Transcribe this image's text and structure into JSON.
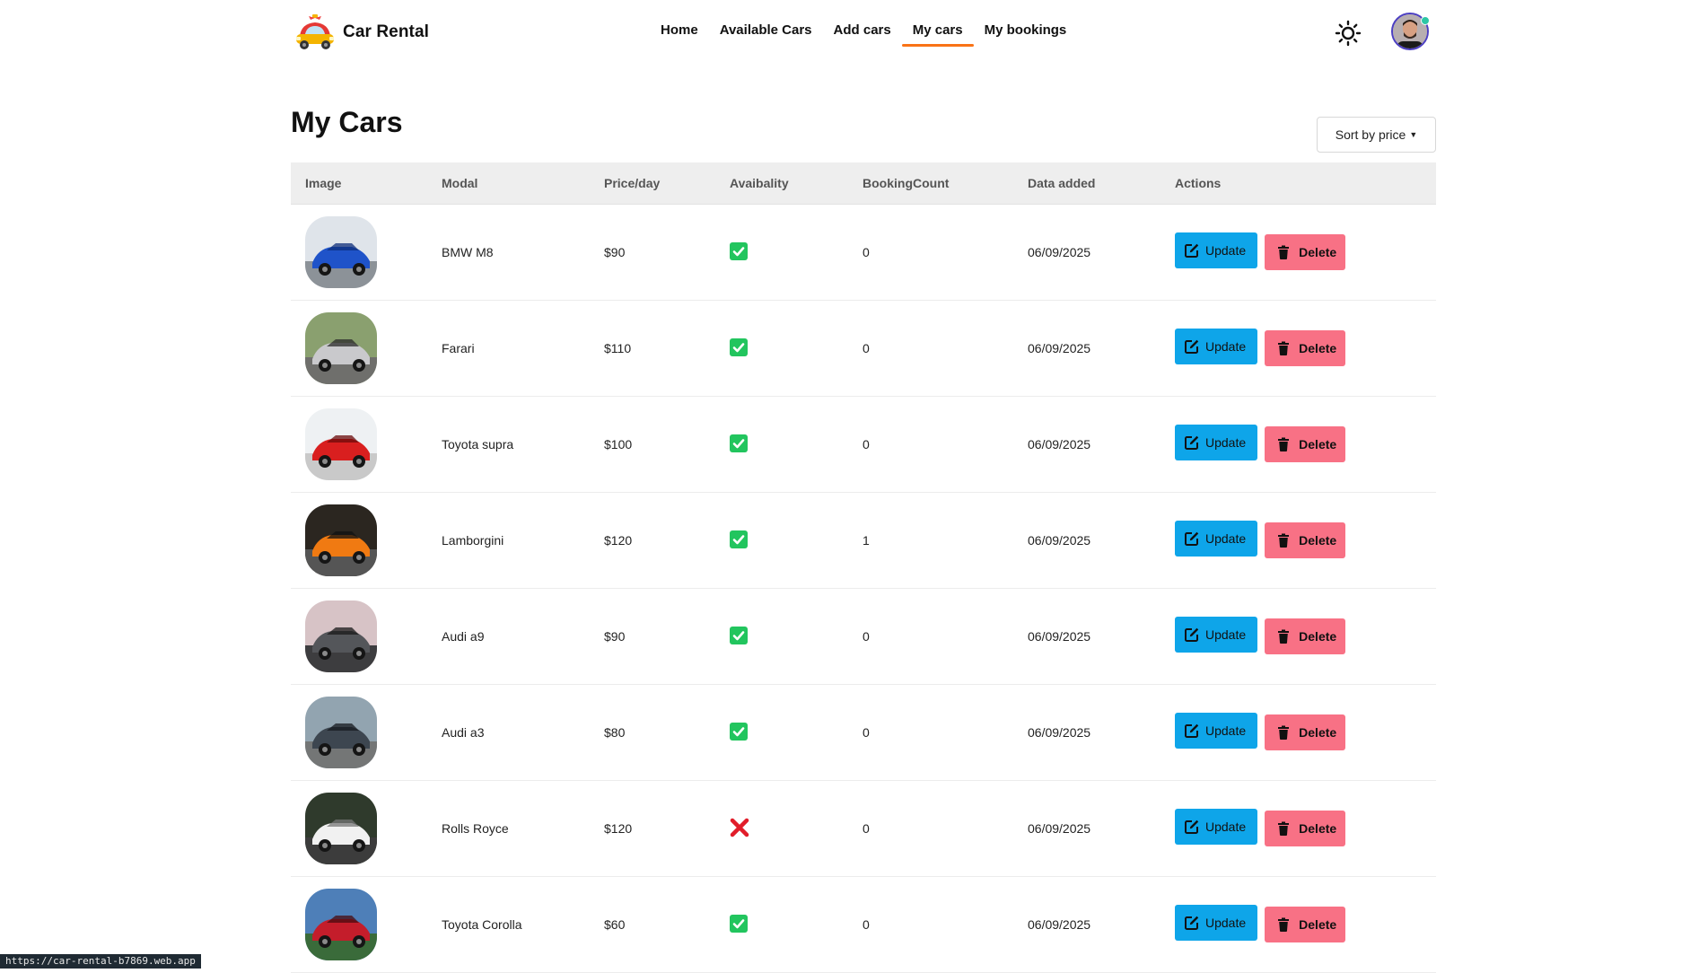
{
  "brand": {
    "name": "Car Rental"
  },
  "nav": {
    "links": [
      {
        "label": "Home",
        "active": false
      },
      {
        "label": "Available Cars",
        "active": false
      },
      {
        "label": "Add cars",
        "active": false
      },
      {
        "label": "My cars",
        "active": true
      },
      {
        "label": "My bookings",
        "active": false
      }
    ]
  },
  "header_icons": {
    "theme": "sun-icon",
    "avatar": "user-avatar"
  },
  "page": {
    "title": "My Cars",
    "sort_label": "Sort by price"
  },
  "table": {
    "headers": [
      "Image",
      "Modal",
      "Price/day",
      "Avaibality",
      "BookingCount",
      "Data added",
      "Actions"
    ],
    "update_label": "Update",
    "delete_label": "Delete",
    "rows": [
      {
        "model": "BMW M8",
        "price": "$90",
        "available": true,
        "count": "0",
        "date": "06/09/2025",
        "photo": "blue-car"
      },
      {
        "model": "Farari",
        "price": "$110",
        "available": true,
        "count": "0",
        "date": "06/09/2025",
        "photo": "silver-supercar"
      },
      {
        "model": "Toyota supra",
        "price": "$100",
        "available": true,
        "count": "0",
        "date": "06/09/2025",
        "photo": "red-classic-car"
      },
      {
        "model": "Lamborgini",
        "price": "$120",
        "available": true,
        "count": "1",
        "date": "06/09/2025",
        "photo": "orange-supercar"
      },
      {
        "model": "Audi a9",
        "price": "$90",
        "available": true,
        "count": "0",
        "date": "06/09/2025",
        "photo": "grey-sports-car"
      },
      {
        "model": "Audi a3",
        "price": "$80",
        "available": true,
        "count": "0",
        "date": "06/09/2025",
        "photo": "dark-grey-sedan"
      },
      {
        "model": "Rolls Royce",
        "price": "$120",
        "available": false,
        "count": "0",
        "date": "06/09/2025",
        "photo": "white-luxury-car"
      },
      {
        "model": "Toyota Corolla",
        "price": "$60",
        "available": true,
        "count": "0",
        "date": "06/09/2025",
        "photo": "red-sedan"
      }
    ]
  },
  "status_bar": {
    "url": "https://car-rental-b7869.web.app"
  },
  "colors": {
    "accent": "#f97316",
    "update": "#0ea5e9",
    "delete": "#f87185",
    "available": "#22c55e",
    "unavailable": "#e11d2a"
  }
}
